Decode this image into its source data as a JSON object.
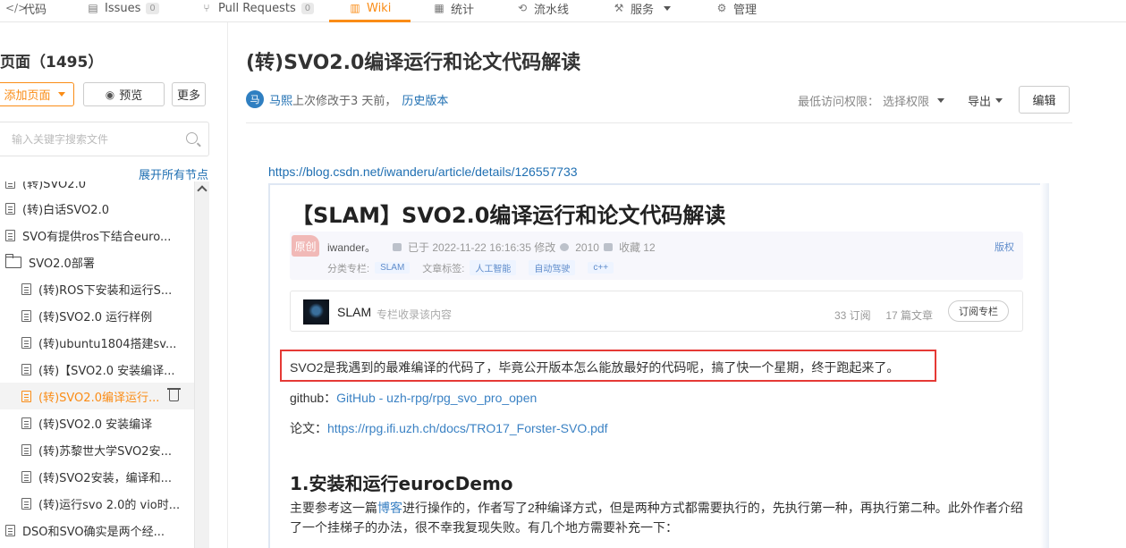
{
  "nav": {
    "items": [
      {
        "label": "代码",
        "icon": "code-icon"
      },
      {
        "label": "Issues",
        "badge": "0",
        "icon": "issues-icon"
      },
      {
        "label": "Pull Requests",
        "badge": "0",
        "icon": "pull-request-icon"
      },
      {
        "label": "Wiki",
        "icon": "wiki-icon",
        "active": true
      },
      {
        "label": "统计",
        "icon": "stats-icon"
      },
      {
        "label": "流水线",
        "icon": "pipeline-icon"
      },
      {
        "label": "服务",
        "icon": "service-icon"
      },
      {
        "label": "管理",
        "icon": "manage-icon"
      }
    ],
    "accent": "#fa8c16"
  },
  "sidebar": {
    "title": "页面（1495）",
    "add_page": "添加页面",
    "preview": "预览",
    "more": "更多",
    "search_placeholder": "输入关键字搜索文件",
    "expand_all": "展开所有节点",
    "items": [
      {
        "label": "(转)SVO2.0"
      },
      {
        "label": "(转)白话SVO2.0"
      },
      {
        "label": "SVO有提供ros下结合euro..."
      },
      {
        "label": "SVO2.0部署"
      },
      {
        "label": "(转)ROS下安装和运行S..."
      },
      {
        "label": "(转)SVO2.0 运行样例"
      },
      {
        "label": "(转)ubuntu1804搭建sv..."
      },
      {
        "label": "(转)【SVO2.0 安装编译..."
      },
      {
        "label": "(转)SVO2.0编译运行..."
      },
      {
        "label": "(转)SVO2.0 安装编译"
      },
      {
        "label": "(转)苏黎世大学SVO2安..."
      },
      {
        "label": "(转)SVO2安装，编译和..."
      },
      {
        "label": "(转)运行svo 2.0的 vio时..."
      },
      {
        "label": "DSO和SVO确实是两个经..."
      }
    ]
  },
  "page": {
    "title": "(转)SVO2.0编译运行和论文代码解读",
    "avatar_text": "马",
    "author": "马熙",
    "modified": "上次修改于3 天前，",
    "history": "历史版本",
    "permission_label": "最低访问权限：",
    "permission_value": "选择权限",
    "export": "导出",
    "edit": "编辑",
    "ref_link": "https://blog.csdn.net/iwanderu/article/details/126557733"
  },
  "embed": {
    "title": "【SLAM】SVO2.0编译运行和论文代码解读",
    "badge": "原创",
    "author": "iwander。",
    "date": "已于 2022-11-22 16:16:35 修改",
    "views": "2010",
    "fav": "收藏 12",
    "copyright": "版权",
    "column_label": "分类专栏:",
    "column_tag": "SLAM",
    "article_tags_label": "文章标签:",
    "tags": [
      "人工智能",
      "自动驾驶",
      "c++"
    ],
    "col_name": "SLAM",
    "col_desc": "专栏收录该内容",
    "col_subs": "33 订阅",
    "col_articles": "17 篇文章",
    "col_btn": "订阅专栏",
    "highlight_text": "SVO2是我遇到的最难编译的代码了，毕竟公开版本怎么能放最好的代码呢，搞了快一个星期，终于跑起来了。",
    "github_label": "github：",
    "github_link": "GitHub - uzh-rpg/rpg_svo_pro_open",
    "paper_label": "论文：",
    "paper_link": "https://rpg.ifi.uzh.ch/docs/TRO17_Forster-SVO.pdf",
    "h2": "1.安装和运行eurocDemo",
    "body_pre": "主要参考这一篇",
    "body_link": "博客",
    "body_post": "进行操作的，作者写了2种编译方式，但是两种方式都需要执行的，先执行第一种，再执行第二种。此外作者介绍了一个挂梯子的办法，很不幸我复现失败。有几个地方需要补充一下："
  }
}
